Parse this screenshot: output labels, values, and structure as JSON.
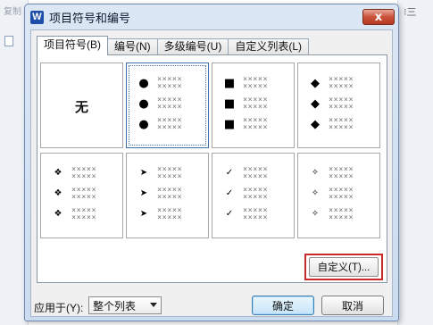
{
  "background": {
    "left_toolbar_text": "复制",
    "right_toolbar_text": "⁝三"
  },
  "dialog": {
    "app_logo": "W",
    "title": "项目符号和编号",
    "close_icon": "x"
  },
  "tabs": [
    {
      "label": "项目符号(B)",
      "active": true
    },
    {
      "label": "编号(N)",
      "active": false
    },
    {
      "label": "多级编号(U)",
      "active": false
    },
    {
      "label": "自定义列表(L)",
      "active": false
    }
  ],
  "bullets": {
    "none_label": "无",
    "placeholder_text": "×××××",
    "cells": [
      {
        "symbol": "",
        "selected": false,
        "is_none": true,
        "icon": "none"
      },
      {
        "symbol": "●",
        "selected": true,
        "icon": "filled-circle-bullet-icon"
      },
      {
        "symbol": "■",
        "selected": false,
        "icon": "filled-square-bullet-icon"
      },
      {
        "symbol": "◆",
        "selected": false,
        "icon": "filled-diamond-bullet-icon"
      },
      {
        "symbol": "❖",
        "selected": false,
        "icon": "four-diamond-bullet-icon"
      },
      {
        "symbol": "➤",
        "selected": false,
        "icon": "arrowhead-bullet-icon"
      },
      {
        "symbol": "✓",
        "selected": false,
        "icon": "checkmark-bullet-icon"
      },
      {
        "symbol": "✧",
        "selected": false,
        "icon": "four-point-star-bullet-icon"
      }
    ]
  },
  "customize_label": "自定义(T)...",
  "footer": {
    "apply_to_label": "应用于(Y):",
    "apply_to_value": "整个列表",
    "ok_label": "确定",
    "cancel_label": "取消"
  },
  "colors": {
    "highlight": "#cc2a2a",
    "selected_border": "#3d6ea5",
    "close_button": "#c9533a"
  }
}
